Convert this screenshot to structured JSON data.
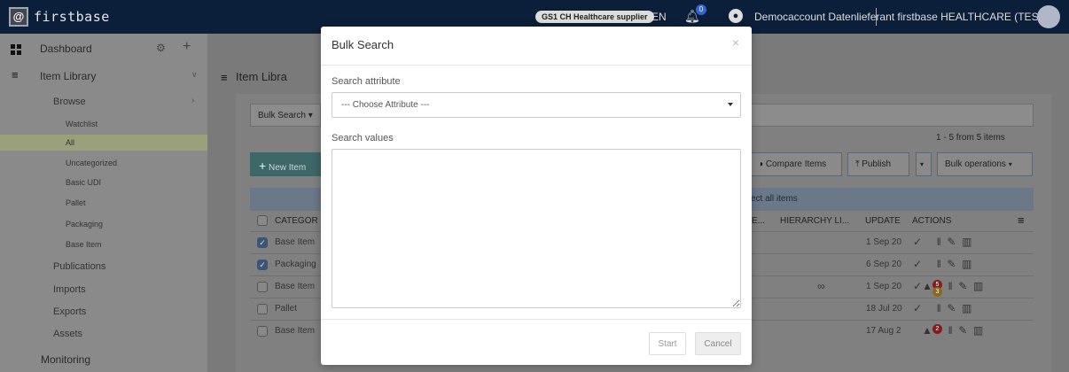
{
  "app": {
    "logo_letter": "@",
    "name": "firstbase",
    "supplier_badge": "GS1 CH Healthcare supplier",
    "language": "EN",
    "notification_count": "0",
    "account": "Democaccount Datenlieferant firstbase HEALTHCARE (TEST)"
  },
  "sidebar": {
    "dashboard": "Dashboard",
    "item_library": "Item Library",
    "browse": "Browse",
    "leaves": [
      "Watchlist",
      "All",
      "Uncategorized",
      "Basic UDI",
      "Pallet",
      "Packaging",
      "Base Item"
    ],
    "publications": "Publications",
    "imports": "Imports",
    "exports": "Exports",
    "assets": "Assets",
    "monitoring": "Monitoring"
  },
  "main": {
    "title": "Item Libra",
    "bulk_search": "Bulk Search ▾",
    "count": "1 - 5 from 5 items",
    "new_item": "New Item",
    "compare_items": "Compare Items",
    "publish": "Publish",
    "bulk_operations": "Bulk operations",
    "select_all": "ect all items",
    "headers": {
      "category": "CATEGOR",
      "e_col": "E...",
      "hierarchy": "HIERARCHY LI...",
      "update": "UPDATE",
      "actions": "ACTIONS"
    },
    "rows": [
      {
        "category": "Base Item",
        "update": "1 Sep 20",
        "checked": true
      },
      {
        "category": "Packaging",
        "update": "6 Sep 20",
        "checked": true
      },
      {
        "category": "Base Item",
        "update": "1 Sep 20",
        "checked": false
      },
      {
        "category": "Pallet",
        "update": "18 Jul 20",
        "checked": false
      },
      {
        "category": "Base Item",
        "update": "17 Aug 2",
        "checked": false
      }
    ],
    "warn_count_a": "5",
    "warn_count_b": "3",
    "warn_count_c": "2"
  },
  "modal": {
    "title": "Bulk Search",
    "close": "×",
    "search_attribute_label": "Search attribute",
    "search_attribute_value": "--- Choose Attribute ---",
    "search_values_label": "Search values",
    "search_values_text": "",
    "start": "Start",
    "cancel": "Cancel"
  },
  "colors": {
    "topbar": "#0b1f3a",
    "overlay_tint": "#7a7a7a",
    "new_item_button": "#3e6767"
  }
}
